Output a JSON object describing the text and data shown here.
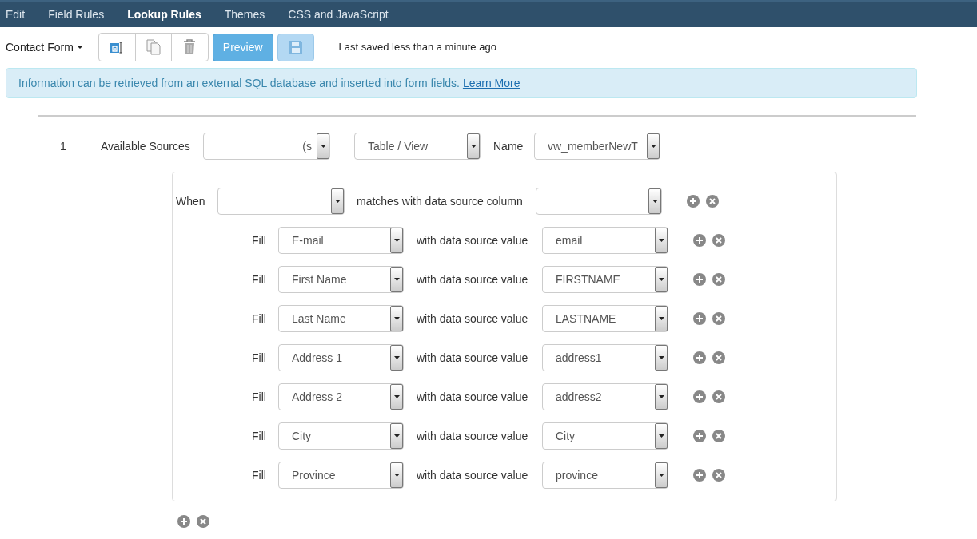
{
  "nav_tabs": [
    {
      "label": "Edit",
      "selected": false
    },
    {
      "label": "Field Rules",
      "selected": false
    },
    {
      "label": "Lookup Rules",
      "selected": true
    },
    {
      "label": "Themes",
      "selected": false
    },
    {
      "label": "CSS and JavaScript",
      "selected": false
    }
  ],
  "toolbar": {
    "form_menu": "Contact Form",
    "preview_button": "Preview",
    "save_disabled": true,
    "save_status": "Last saved less than a minute ago"
  },
  "alert": {
    "text": "Information can be retrieved from an external SQL database and inserted into form fields.",
    "link": "Learn More"
  },
  "rule": {
    "number": "1",
    "sources_label": "Available Sources",
    "source_value": "(s",
    "object_type": "Table / View",
    "name_label": "Name",
    "name_value": "vw_memberNewT",
    "when": {
      "label": "When",
      "middle_text": "matches with data source column"
    },
    "fills": [
      {
        "label": "Fill",
        "field": "E-mail",
        "text": "with data source value",
        "column": "email"
      },
      {
        "label": "Fill",
        "field": "First Name",
        "text": "with data source value",
        "column": "FIRSTNAME"
      },
      {
        "label": "Fill",
        "field": "Last Name",
        "text": "with data source value",
        "column": "LASTNAME"
      },
      {
        "label": "Fill",
        "field": "Address 1",
        "text": "with data source value",
        "column": "address1"
      },
      {
        "label": "Fill",
        "field": "Address 2",
        "text": "with data source value",
        "column": "address2"
      },
      {
        "label": "Fill",
        "field": "City",
        "text": "with data source value",
        "column": "City"
      },
      {
        "label": "Fill",
        "field": "Province",
        "text": "with data source value",
        "column": "province"
      }
    ]
  }
}
